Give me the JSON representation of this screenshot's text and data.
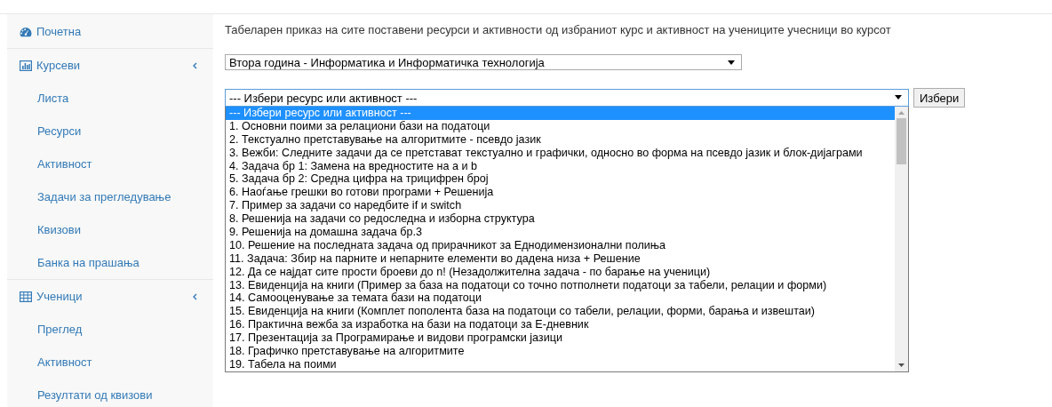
{
  "sidebar": {
    "sections": [
      {
        "label": "Почетна"
      },
      {
        "label": "Курсеви",
        "children": [
          {
            "label": "Листа"
          },
          {
            "label": "Ресурси"
          },
          {
            "label": "Активност"
          },
          {
            "label": "Задачи за прегледување"
          },
          {
            "label": "Квизови"
          },
          {
            "label": "Банка на прашања"
          }
        ]
      },
      {
        "label": "Ученици",
        "children": [
          {
            "label": "Преглед"
          },
          {
            "label": "Активност"
          },
          {
            "label": "Резултати од квизови"
          }
        ]
      }
    ]
  },
  "main": {
    "description": "Табеларен приказ на сите поставени ресурси и активности од избраниот курс и активност на учениците учесници во курсот",
    "course_select": {
      "value": "Втора година - Информатика и Информатичка технологија"
    },
    "resource_select": {
      "value": "--- Избери ресурс или активност ---",
      "options": [
        {
          "label": "--- Избери ресурс или активност ---",
          "selected": true
        },
        {
          "label": "1. Основни поими за релациони бази на податоци",
          "selected": false
        },
        {
          "label": "2. Текстуално претставување на алгоритмите - псевдо јазик",
          "selected": false
        },
        {
          "label": "3. Вежби: Следните задачи да се претстават текстуално и графички, односно во форма на псевдо јазик и блок-дијаграми",
          "selected": false
        },
        {
          "label": "4. Задача бр 1: Замена на вредностите на а и b",
          "selected": false
        },
        {
          "label": "5. Задача бр 2: Средна цифра на трицифрен број",
          "selected": false
        },
        {
          "label": "6. Наоѓање грешки во готови програми + Решенија",
          "selected": false
        },
        {
          "label": "7. Пример за задачи со наредбите if и switch",
          "selected": false
        },
        {
          "label": "8. Решенија на задачи со редоследна и изборна структура",
          "selected": false
        },
        {
          "label": "9. Решенија на домашна задача бр.3",
          "selected": false
        },
        {
          "label": "10. Решение на последната задача од прирачникот за Еднодимензионални полиња",
          "selected": false
        },
        {
          "label": "11. Задача: Збир на парните и непарните елементи во дадена низа + Решение",
          "selected": false
        },
        {
          "label": "12. Да се најдат сите прости броеви до n! (Незадолжителна задача - по барање на ученици)",
          "selected": false
        },
        {
          "label": "13. Евиденција на книги (Пример за база на податоци со точно потполнети податоци за табели, релации и форми)",
          "selected": false
        },
        {
          "label": "14. Самооценување за темата бази на податоци",
          "selected": false
        },
        {
          "label": "15. Евиденција на книги (Комплет пополента база на податоци со табели, релации, форми, барања и извештаи)",
          "selected": false
        },
        {
          "label": "16. Практична вежба за изработка на бази на податоци за Е-дневник",
          "selected": false
        },
        {
          "label": "17. Презентација за Програмирање и видови програмски јазици",
          "selected": false
        },
        {
          "label": "18. Графичко претставување на алгоритмите",
          "selected": false
        },
        {
          "label": "19. Табела на поими",
          "selected": false
        }
      ]
    },
    "submit_button": "Избери"
  }
}
